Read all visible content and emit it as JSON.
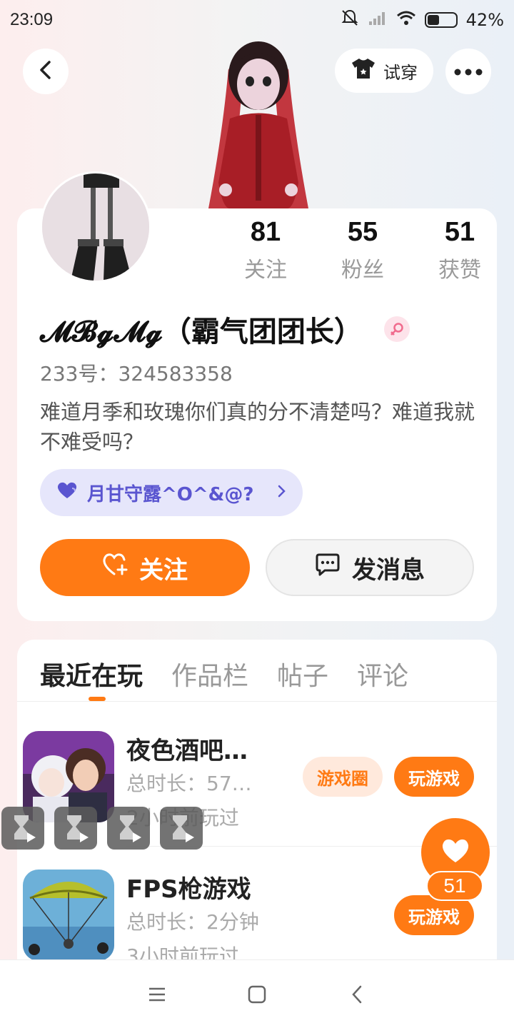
{
  "status_bar": {
    "time": "23:09",
    "battery": "42%",
    "battery_level": 0.42
  },
  "header": {
    "try_on_label": "试穿"
  },
  "profile": {
    "stats": [
      {
        "value": "81",
        "label": "关注"
      },
      {
        "value": "55",
        "label": "粉丝"
      },
      {
        "value": "51",
        "label": "获赞"
      }
    ],
    "nickname": "𝓜𝓑𝓰𝓜𝓰（霸气团团长）",
    "uid": "233号：324583358",
    "bio": "难道月季和玫瑰你们真的分不清楚吗？难道我就不难受吗？",
    "guard_label": "月甘守露^O^&@?",
    "follow_label": "关注",
    "message_label": "发消息"
  },
  "tabs": [
    "最近在玩",
    "作品栏",
    "帖子",
    "评论"
  ],
  "games": [
    {
      "name": "夜色酒吧…",
      "duration": "总时长：57…",
      "last_played": "2小时前玩过",
      "circle_label": "游戏圈",
      "play_label": "玩游戏"
    },
    {
      "name": "FPS枪游戏",
      "duration": "总时长：2分钟",
      "last_played": "3小时前玩过",
      "play_label": "玩游戏"
    }
  ],
  "like": {
    "count": "51"
  },
  "colors": {
    "accent": "#ff7a14",
    "guard_bg": "#e6e6fb",
    "guard_text": "#5a55d0"
  }
}
